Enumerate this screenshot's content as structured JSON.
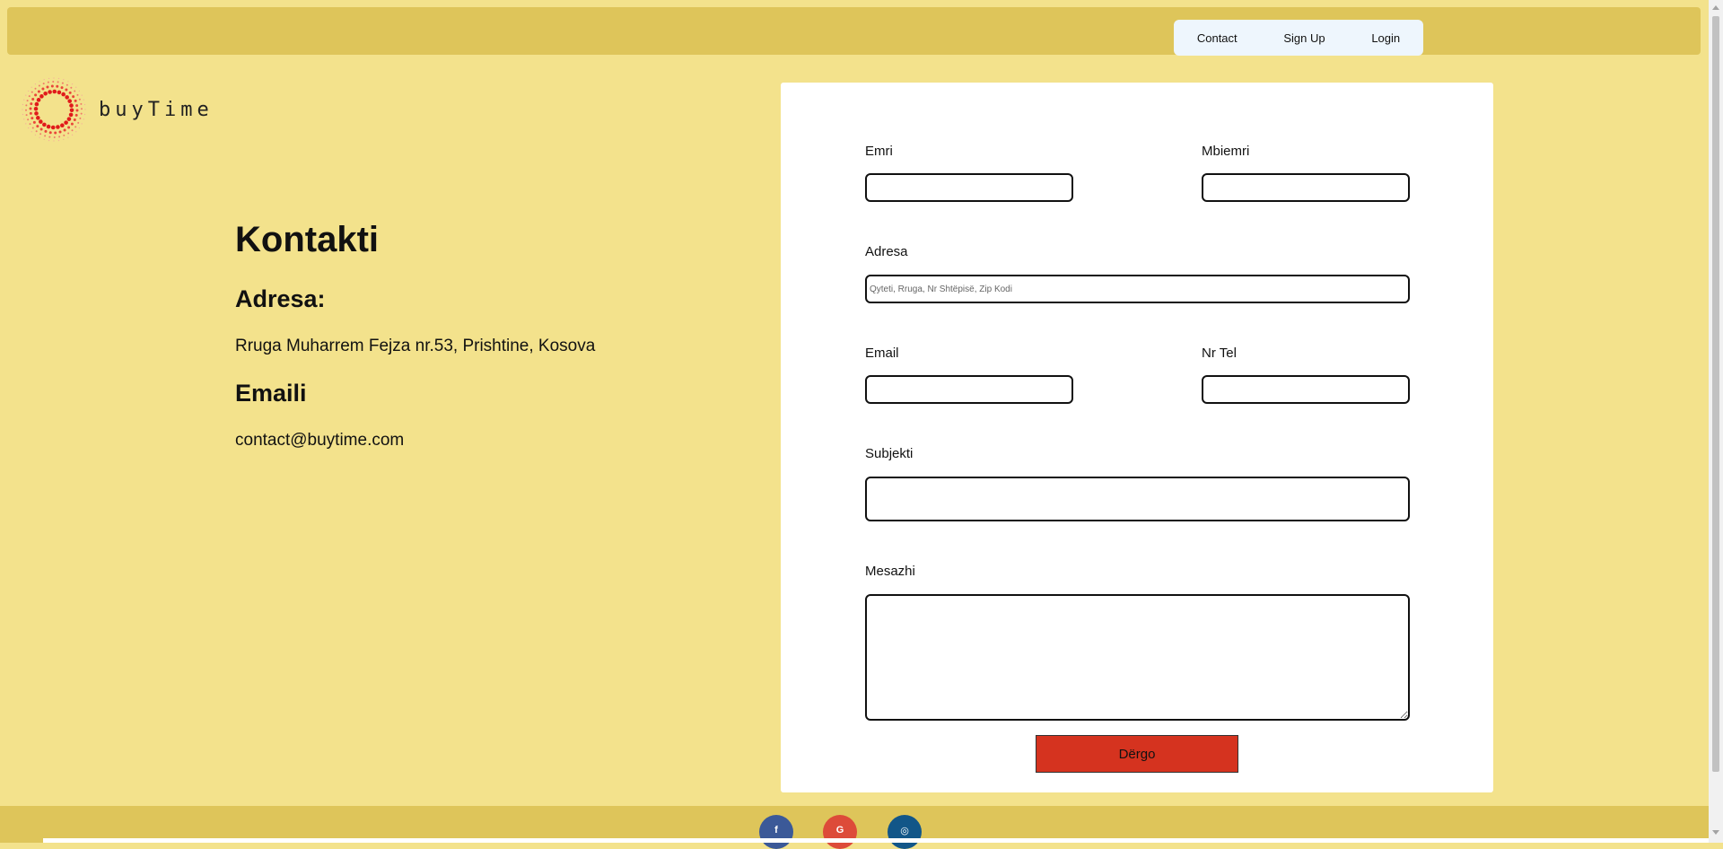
{
  "nav": {
    "contact": "Contact",
    "signup": "Sign Up",
    "login": "Login"
  },
  "brand": {
    "name": "buyTime"
  },
  "contact": {
    "title": "Kontakti",
    "address_heading": "Adresa:",
    "address": "Rruga Muharrem Fejza nr.53, Prishtine, Kosova",
    "email_heading": "Emaili",
    "email": "contact@buytime.com"
  },
  "form": {
    "first_name_label": "Emri",
    "last_name_label": "Mbiemri",
    "address_label": "Adresa",
    "address_placeholder": "Qyteti, Rruga, Nr Shtëpisë, Zip Kodi",
    "email_label": "Email",
    "phone_label": "Nr Tel",
    "subject_label": "Subjekti",
    "message_label": "Mesazhi",
    "submit_label": "Dërgo"
  },
  "social": {
    "facebook": "f",
    "google": "G",
    "instagram": "◎"
  },
  "colors": {
    "page_bg": "#f3e28c",
    "bar_bg": "#dec55a",
    "button": "#d5331f",
    "facebook": "#3b5998",
    "google": "#dd4b39",
    "instagram": "#125688"
  }
}
